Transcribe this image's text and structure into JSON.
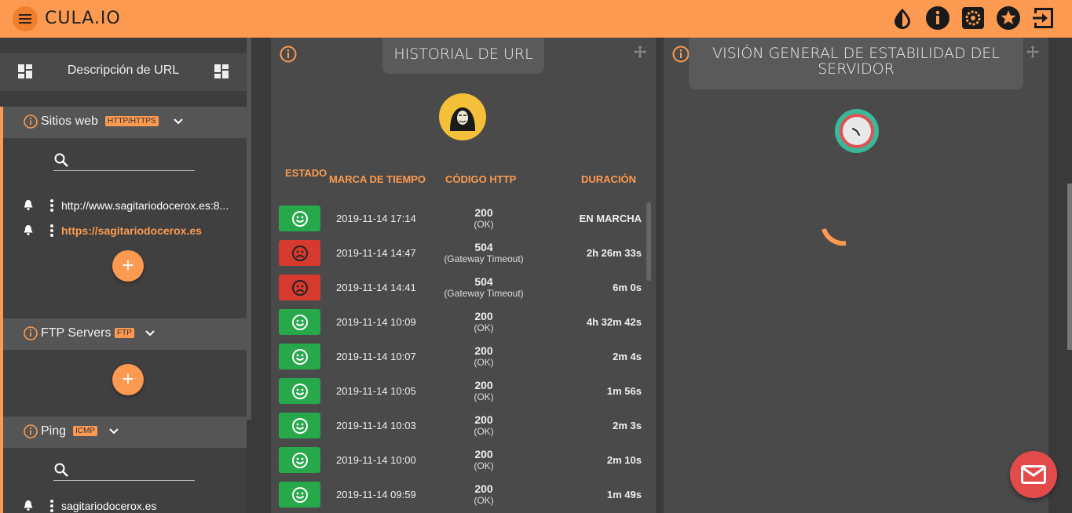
{
  "app": {
    "brand": "CULA.IO"
  },
  "header_icons": [
    "contrast-icon",
    "info-icon",
    "settings-icon",
    "star-icon",
    "logout-icon"
  ],
  "sidebar": {
    "description_label": "Descripción de URL",
    "sections": [
      {
        "title": "Sitios web",
        "tag": "HTTP/HTTPS",
        "sites": [
          {
            "url": "http://www.sagitariodocerox.es:8...",
            "active": false
          },
          {
            "url": "https://sagitariodocerox.es",
            "active": true
          }
        ]
      },
      {
        "title": "FTP Servers",
        "tag": "FTP",
        "sites": []
      },
      {
        "title": "Ping",
        "tag": "ICMP",
        "sites": [
          {
            "url": "sagitariodocerox.es",
            "active": false
          }
        ]
      }
    ]
  },
  "url_history": {
    "title": "HISTORIAL DE URL",
    "columns": [
      "ESTADO",
      "MARCA DE TIEMPO",
      "CÓDIGO HTTP",
      "DURACIÓN"
    ],
    "rows": [
      {
        "status": "ok",
        "timestamp": "2019-11-14 17:14",
        "code": "200",
        "code_text": "(OK)",
        "duration": "EN MARCHA"
      },
      {
        "status": "bad",
        "timestamp": "2019-11-14 14:47",
        "code": "504",
        "code_text": "(Gateway Timeout)",
        "duration": "2h 26m 33s"
      },
      {
        "status": "bad",
        "timestamp": "2019-11-14 14:41",
        "code": "504",
        "code_text": "(Gateway Timeout)",
        "duration": "6m 0s"
      },
      {
        "status": "ok",
        "timestamp": "2019-11-14 10:09",
        "code": "200",
        "code_text": "(OK)",
        "duration": "4h 32m 42s"
      },
      {
        "status": "ok",
        "timestamp": "2019-11-14 10:07",
        "code": "200",
        "code_text": "(OK)",
        "duration": "2m 4s"
      },
      {
        "status": "ok",
        "timestamp": "2019-11-14 10:05",
        "code": "200",
        "code_text": "(OK)",
        "duration": "1m 56s"
      },
      {
        "status": "ok",
        "timestamp": "2019-11-14 10:03",
        "code": "200",
        "code_text": "(OK)",
        "duration": "2m 3s"
      },
      {
        "status": "ok",
        "timestamp": "2019-11-14 10:00",
        "code": "200",
        "code_text": "(OK)",
        "duration": "2m 10s"
      },
      {
        "status": "ok",
        "timestamp": "2019-11-14 09:59",
        "code": "200",
        "code_text": "(OK)",
        "duration": "1m 49s"
      }
    ]
  },
  "stability": {
    "title": "VISIÓN GENERAL DE ESTABILIDAD DEL SERVIDOR"
  },
  "colors": {
    "accent": "#fb9a50",
    "ok": "#27a84a",
    "bad": "#d63a2f",
    "mail": "#e34b4b"
  }
}
